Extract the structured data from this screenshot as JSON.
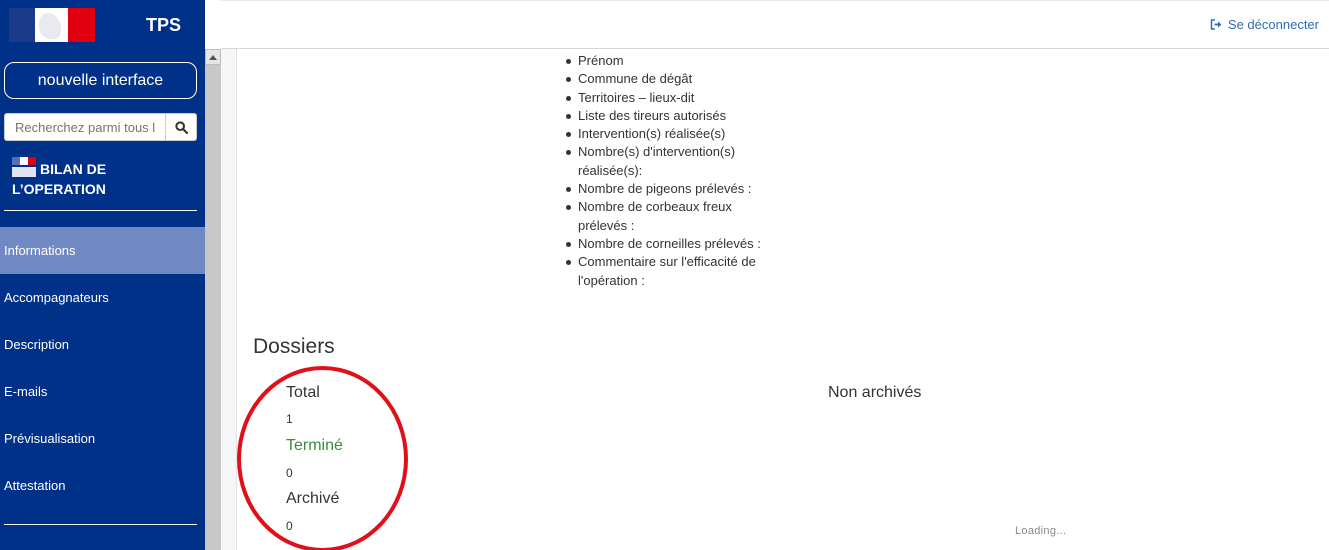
{
  "header": {
    "app_name": "TPS",
    "logout_label": "Se déconnecter"
  },
  "sidebar": {
    "new_ui_button": "nouvelle interface",
    "search_placeholder": "Recherchez parmi tous les dossiers",
    "procedure_title": "BILAN DE L’OPERATION",
    "nav": [
      {
        "label": "Informations",
        "active": true
      },
      {
        "label": "Accompagnateurs"
      },
      {
        "label": "Description"
      },
      {
        "label": "E-mails"
      },
      {
        "label": "Prévisualisation"
      },
      {
        "label": "Attestation"
      }
    ]
  },
  "fields": [
    "Prénom",
    "Commune de dégât",
    "Territoires – lieux-dit",
    "Liste des tireurs autorisés",
    "Intervention(s) réalisée(s)",
    "Nombre(s) d'intervention(s) réalisée(s):",
    "Nombre de pigeons prélevés :",
    "Nombre de corbeaux freux prélevés :",
    "Nombre de corneilles prélevés :",
    "Commentaire sur l'efficacité de l'opération :"
  ],
  "dossiers": {
    "title": "Dossiers",
    "total_label": "Total",
    "total_value": "1",
    "termine_label": "Terminé",
    "termine_value": "0",
    "archive_label": "Archivé",
    "archive_value": "0",
    "non_archives_label": "Non archivés",
    "loading_label": "Loading..."
  },
  "colors": {
    "sidebar_bg": "#003189",
    "active_item": "#7189c2",
    "link": "#2e6db4",
    "annotation": "#e0101a"
  }
}
